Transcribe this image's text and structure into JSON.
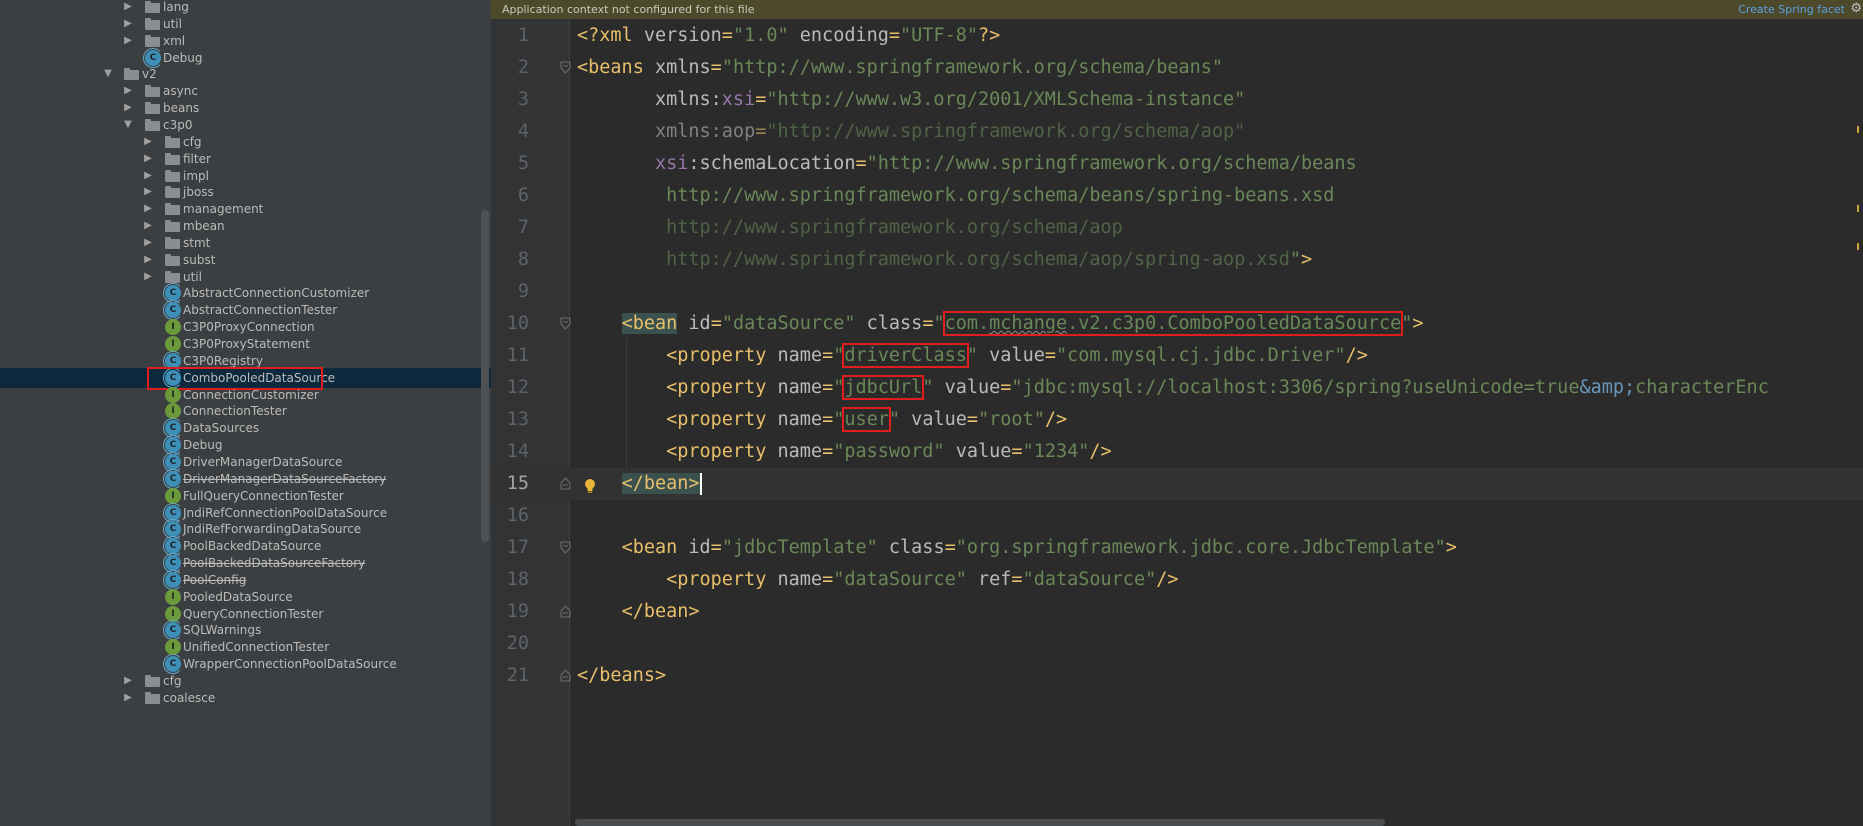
{
  "sidebar": {
    "rows": [
      {
        "label": "lang",
        "type": "folder",
        "depth": 2,
        "arrow": "collapsed"
      },
      {
        "label": "util",
        "type": "folder",
        "depth": 2,
        "arrow": "collapsed"
      },
      {
        "label": "xml",
        "type": "folder",
        "depth": 2,
        "arrow": "collapsed"
      },
      {
        "label": "Debug",
        "type": "class",
        "depth": 2,
        "arrow": "none"
      },
      {
        "label": "v2",
        "type": "folder",
        "depth": 1,
        "arrow": "expanded"
      },
      {
        "label": "async",
        "type": "folder",
        "depth": 2,
        "arrow": "collapsed"
      },
      {
        "label": "beans",
        "type": "folder",
        "depth": 2,
        "arrow": "collapsed"
      },
      {
        "label": "c3p0",
        "type": "folder",
        "depth": 2,
        "arrow": "expanded"
      },
      {
        "label": "cfg",
        "type": "folder",
        "depth": 3,
        "arrow": "collapsed"
      },
      {
        "label": "filter",
        "type": "folder",
        "depth": 3,
        "arrow": "collapsed"
      },
      {
        "label": "impl",
        "type": "folder",
        "depth": 3,
        "arrow": "collapsed"
      },
      {
        "label": "jboss",
        "type": "folder",
        "depth": 3,
        "arrow": "collapsed"
      },
      {
        "label": "management",
        "type": "folder",
        "depth": 3,
        "arrow": "collapsed"
      },
      {
        "label": "mbean",
        "type": "folder",
        "depth": 3,
        "arrow": "collapsed"
      },
      {
        "label": "stmt",
        "type": "folder",
        "depth": 3,
        "arrow": "collapsed"
      },
      {
        "label": "subst",
        "type": "folder",
        "depth": 3,
        "arrow": "collapsed"
      },
      {
        "label": "util",
        "type": "folder",
        "depth": 3,
        "arrow": "collapsed"
      },
      {
        "label": "AbstractConnectionCustomizer",
        "type": "class",
        "depth": 3,
        "arrow": "none"
      },
      {
        "label": "AbstractConnectionTester",
        "type": "class",
        "depth": 3,
        "arrow": "none"
      },
      {
        "label": "C3P0ProxyConnection",
        "type": "interface",
        "depth": 3,
        "arrow": "none"
      },
      {
        "label": "C3P0ProxyStatement",
        "type": "interface",
        "depth": 3,
        "arrow": "none"
      },
      {
        "label": "C3P0Registry",
        "type": "class",
        "depth": 3,
        "arrow": "none"
      },
      {
        "label": "ComboPooledDataSource",
        "type": "class",
        "depth": 3,
        "arrow": "none",
        "selected": true,
        "boxed": true
      },
      {
        "label": "ConnectionCustomizer",
        "type": "interface",
        "depth": 3,
        "arrow": "none"
      },
      {
        "label": "ConnectionTester",
        "type": "interface",
        "depth": 3,
        "arrow": "none"
      },
      {
        "label": "DataSources",
        "type": "class",
        "depth": 3,
        "arrow": "none"
      },
      {
        "label": "Debug",
        "type": "class",
        "depth": 3,
        "arrow": "none"
      },
      {
        "label": "DriverManagerDataSource",
        "type": "class",
        "depth": 3,
        "arrow": "none"
      },
      {
        "label": "DriverManagerDataSourceFactory",
        "type": "class",
        "depth": 3,
        "arrow": "none",
        "strike": true
      },
      {
        "label": "FullQueryConnectionTester",
        "type": "interface",
        "depth": 3,
        "arrow": "none"
      },
      {
        "label": "JndiRefConnectionPoolDataSource",
        "type": "class",
        "depth": 3,
        "arrow": "none"
      },
      {
        "label": "JndiRefForwardingDataSource",
        "type": "class",
        "depth": 3,
        "arrow": "none"
      },
      {
        "label": "PoolBackedDataSource",
        "type": "class",
        "depth": 3,
        "arrow": "none"
      },
      {
        "label": "PoolBackedDataSourceFactory",
        "type": "class",
        "depth": 3,
        "arrow": "none",
        "strike": true
      },
      {
        "label": "PoolConfig",
        "type": "class",
        "depth": 3,
        "arrow": "none",
        "strike": true
      },
      {
        "label": "PooledDataSource",
        "type": "interface",
        "depth": 3,
        "arrow": "none"
      },
      {
        "label": "QueryConnectionTester",
        "type": "interface",
        "depth": 3,
        "arrow": "none"
      },
      {
        "label": "SQLWarnings",
        "type": "class",
        "depth": 3,
        "arrow": "none"
      },
      {
        "label": "UnifiedConnectionTester",
        "type": "interface",
        "depth": 3,
        "arrow": "none"
      },
      {
        "label": "WrapperConnectionPoolDataSource",
        "type": "class",
        "depth": 3,
        "arrow": "none"
      },
      {
        "label": "cfg",
        "type": "folder",
        "depth": 2,
        "arrow": "collapsed"
      },
      {
        "label": "coalesce",
        "type": "folder",
        "depth": 2,
        "arrow": "collapsed"
      }
    ]
  },
  "banner": {
    "message": "Application context not configured for this file",
    "action": "Create Spring facet",
    "gear": "⚙"
  },
  "editor": {
    "current_line": 15,
    "lines": [
      {
        "n": "1",
        "tokens": [
          [
            "tg",
            "<?xml "
          ],
          [
            "an",
            "version"
          ],
          [
            "tg",
            "="
          ],
          [
            "st",
            "\"1.0\""
          ],
          [
            "an",
            " encoding"
          ],
          [
            "tg",
            "="
          ],
          [
            "st",
            "\"UTF-8\""
          ],
          [
            "tg",
            "?>"
          ]
        ]
      },
      {
        "n": "2",
        "fold": "open",
        "tokens": [
          [
            "tg",
            "<beans "
          ],
          [
            "an",
            "xmlns"
          ],
          [
            "tg",
            "="
          ],
          [
            "st",
            "\"http://www.springframework.org/schema/beans\""
          ]
        ]
      },
      {
        "n": "3",
        "tokens": [
          [
            "pl",
            "       "
          ],
          [
            "an",
            "xmlns:"
          ],
          [
            "ns",
            "xsi"
          ],
          [
            "tg",
            "="
          ],
          [
            "st",
            "\"http://www.w3.org/2001/XMLSchema-instance\""
          ]
        ]
      },
      {
        "n": "4",
        "tokens": [
          [
            "pl",
            "       "
          ],
          [
            "an dim",
            "xmlns:aop"
          ],
          [
            "tg dim",
            "="
          ],
          [
            "st dim",
            "\"http://www.springframework.org/schema/aop\""
          ]
        ]
      },
      {
        "n": "5",
        "tokens": [
          [
            "pl",
            "       "
          ],
          [
            "ns",
            "xsi"
          ],
          [
            "an",
            ":schemaLocation"
          ],
          [
            "tg",
            "="
          ],
          [
            "st",
            "\"http://www.springframework.org/schema/beans"
          ]
        ]
      },
      {
        "n": "6",
        "tokens": [
          [
            "pl",
            "        "
          ],
          [
            "st",
            "http://www.springframework.org/schema/beans/spring-beans.xsd"
          ]
        ]
      },
      {
        "n": "7",
        "tokens": [
          [
            "pl",
            "        "
          ],
          [
            "st dim",
            "http://www.springframework.org/schema/aop"
          ]
        ]
      },
      {
        "n": "8",
        "tokens": [
          [
            "pl",
            "        "
          ],
          [
            "st dim",
            "http://www.springframework.org/schema/aop/spring-aop.xsd"
          ],
          [
            "st",
            "\""
          ],
          [
            "tg",
            ">"
          ]
        ]
      },
      {
        "n": "9",
        "tokens": []
      },
      {
        "n": "10",
        "fold": "open",
        "tokens": [
          [
            "pl",
            "    "
          ],
          [
            "tg tagbg",
            "<bean"
          ],
          [
            "an",
            " id"
          ],
          [
            "tg",
            "="
          ],
          [
            "st",
            "\"dataSource\""
          ],
          [
            "an",
            " class"
          ],
          [
            "tg",
            "="
          ],
          [
            "st",
            "\""
          ],
          [
            "st box",
            "com.mchange.v2.c3p0.ComboPooledDataSource"
          ],
          [
            "st",
            "\""
          ],
          [
            "tg",
            ">"
          ]
        ]
      },
      {
        "n": "11",
        "tokens": [
          [
            "pl",
            "        "
          ],
          [
            "tg",
            "<property "
          ],
          [
            "an",
            "name"
          ],
          [
            "tg",
            "="
          ],
          [
            "st",
            "\""
          ],
          [
            "st box",
            "driverClass"
          ],
          [
            "st",
            "\""
          ],
          [
            "an",
            " value"
          ],
          [
            "tg",
            "="
          ],
          [
            "st",
            "\"com.mysql.cj.jdbc.Driver\""
          ],
          [
            "tg",
            "/>"
          ]
        ]
      },
      {
        "n": "12",
        "tokens": [
          [
            "pl",
            "        "
          ],
          [
            "tg",
            "<property "
          ],
          [
            "an",
            "name"
          ],
          [
            "tg",
            "="
          ],
          [
            "st",
            "\""
          ],
          [
            "st box",
            "jdbcUrl"
          ],
          [
            "st",
            "\""
          ],
          [
            "an",
            " value"
          ],
          [
            "tg",
            "="
          ],
          [
            "st",
            "\"jdbc:mysql://localhost:3306/spring?useUnicode=true"
          ],
          [
            "ent",
            "&amp;"
          ],
          [
            "st",
            "characterEnc"
          ]
        ]
      },
      {
        "n": "13",
        "tokens": [
          [
            "pl",
            "        "
          ],
          [
            "tg",
            "<property "
          ],
          [
            "an",
            "name"
          ],
          [
            "tg",
            "="
          ],
          [
            "st",
            "\""
          ],
          [
            "st box",
            "user"
          ],
          [
            "st",
            "\""
          ],
          [
            "an",
            " value"
          ],
          [
            "tg",
            "="
          ],
          [
            "st",
            "\"root\""
          ],
          [
            "tg",
            "/>"
          ]
        ]
      },
      {
        "n": "14",
        "tokens": [
          [
            "pl",
            "        "
          ],
          [
            "tg",
            "<property "
          ],
          [
            "an",
            "name"
          ],
          [
            "tg",
            "="
          ],
          [
            "st",
            "\"password\""
          ],
          [
            "an",
            " value"
          ],
          [
            "tg",
            "="
          ],
          [
            "st",
            "\"1234\""
          ],
          [
            "tg",
            "/>"
          ]
        ]
      },
      {
        "n": "15",
        "fold": "close",
        "bulb": true,
        "current": true,
        "tokens": [
          [
            "pl",
            "    "
          ],
          [
            "tg tagbg",
            "</bean>"
          ],
          [
            "caret",
            ""
          ]
        ]
      },
      {
        "n": "16",
        "tokens": []
      },
      {
        "n": "17",
        "fold": "open",
        "tokens": [
          [
            "pl",
            "    "
          ],
          [
            "tg",
            "<bean "
          ],
          [
            "an",
            "id"
          ],
          [
            "tg",
            "="
          ],
          [
            "st",
            "\"jdbcTemplate\""
          ],
          [
            "an",
            " class"
          ],
          [
            "tg",
            "="
          ],
          [
            "st",
            "\"org.springframework.jdbc.core.JdbcTemplate\""
          ],
          [
            "tg",
            ">"
          ]
        ]
      },
      {
        "n": "18",
        "tokens": [
          [
            "pl",
            "        "
          ],
          [
            "tg",
            "<property "
          ],
          [
            "an",
            "name"
          ],
          [
            "tg",
            "="
          ],
          [
            "st",
            "\"dataSource\""
          ],
          [
            "an",
            " ref"
          ],
          [
            "tg",
            "="
          ],
          [
            "st",
            "\"dataSource\""
          ],
          [
            "tg",
            "/>"
          ]
        ]
      },
      {
        "n": "19",
        "fold": "close",
        "tokens": [
          [
            "pl",
            "    "
          ],
          [
            "tg",
            "</bean>"
          ]
        ]
      },
      {
        "n": "20",
        "tokens": []
      },
      {
        "n": "21",
        "fold": "close",
        "tokens": [
          [
            "tg",
            "</beans>"
          ]
        ]
      }
    ]
  },
  "colors": {
    "sidebar_bg": "#3c3f41",
    "editor_bg": "#2b2b2b",
    "tag": "#e8bf6a",
    "string": "#6a8759",
    "namespace": "#9876aa",
    "highlight_box": "#e01e1e",
    "selection": "#0d293e"
  }
}
